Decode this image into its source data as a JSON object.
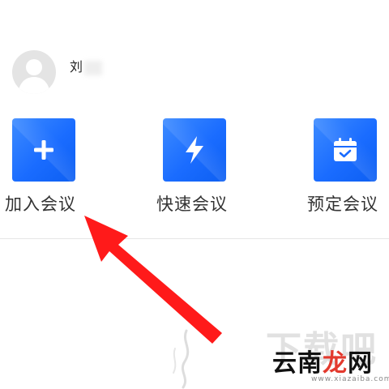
{
  "profile": {
    "name": "刘",
    "avatar_icon": "default-avatar-icon"
  },
  "actions": [
    {
      "label": "加入会议",
      "icon": "plus-icon"
    },
    {
      "label": "快速会议",
      "icon": "lightning-icon"
    },
    {
      "label": "预定会议",
      "icon": "calendar-check-icon"
    }
  ],
  "colors": {
    "tile_gradient_start": "#3d8bff",
    "tile_gradient_end": "#0d5ff2",
    "annotation_arrow": "#ff1a1a",
    "watermark_accent": "#e33a2e"
  },
  "watermark": {
    "faint_text": "下载吧",
    "brand_prefix": "云南",
    "brand_accent": "龙",
    "brand_suffix": "网",
    "url": "www.xiazaiba.com"
  }
}
